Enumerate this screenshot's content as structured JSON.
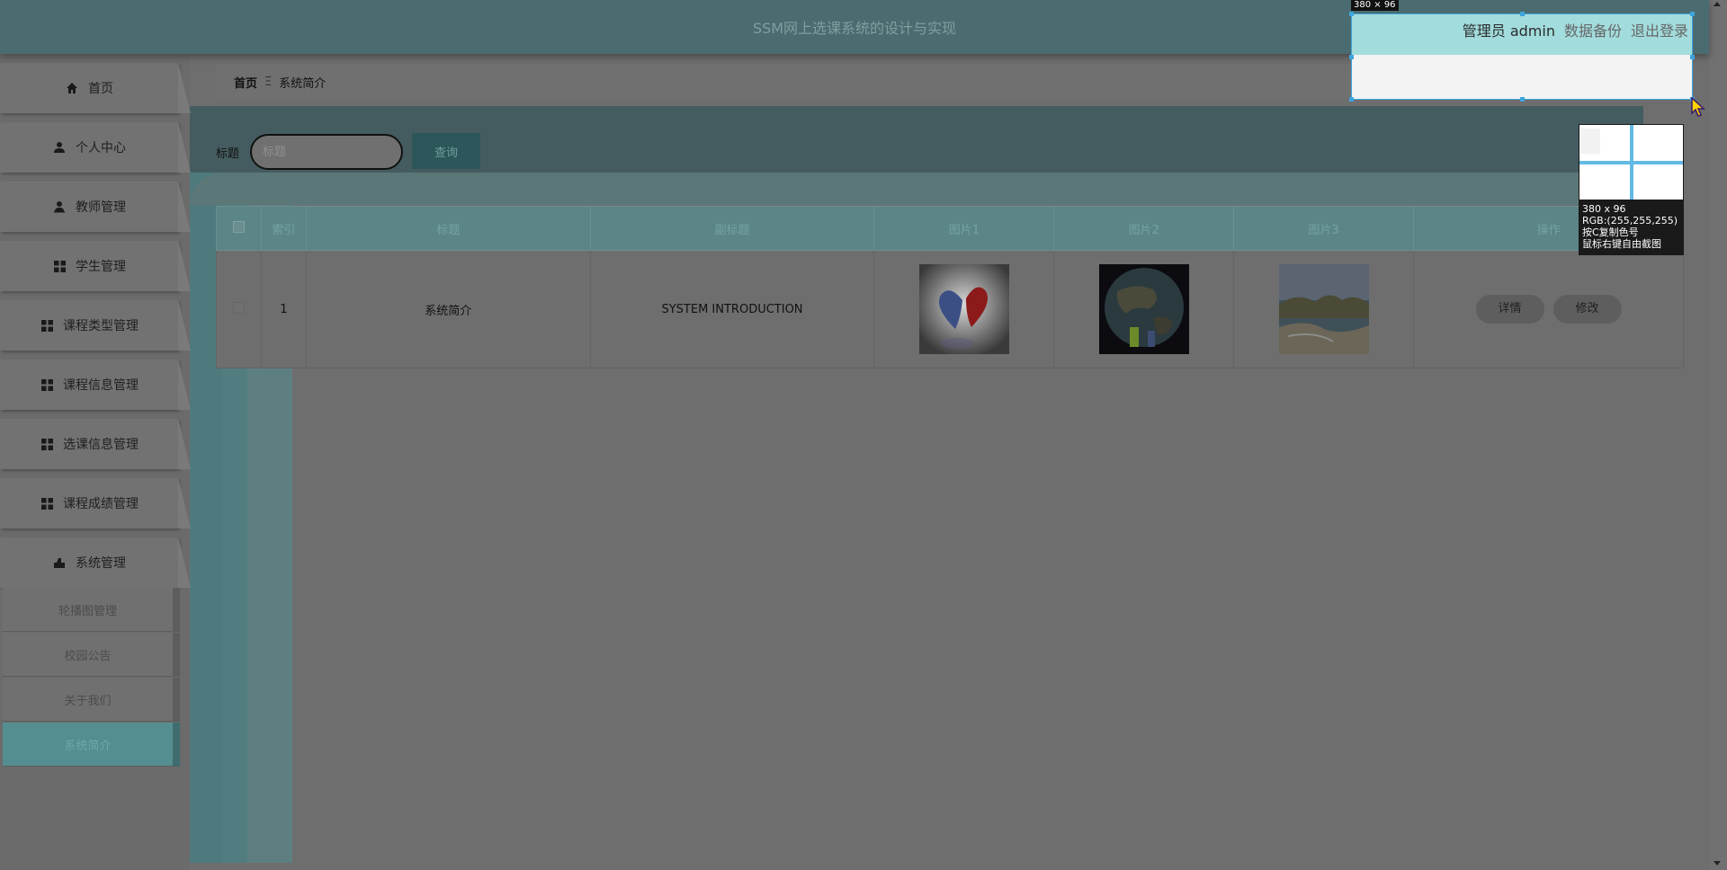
{
  "header": {
    "title": "SSM网上选课系统的设计与实现"
  },
  "user": {
    "role_name": "管理员 admin",
    "backup_label": "数据备份",
    "logout_label": "退出登录"
  },
  "sidebar": {
    "items": [
      {
        "label": "首页",
        "icon": "home-icon"
      },
      {
        "label": "个人中心",
        "icon": "user-icon"
      },
      {
        "label": "教师管理",
        "icon": "teacher-icon"
      },
      {
        "label": "学生管理",
        "icon": "grid-icon"
      },
      {
        "label": "课程类型管理",
        "icon": "grid-icon"
      },
      {
        "label": "课程信息管理",
        "icon": "grid-icon"
      },
      {
        "label": "选课信息管理",
        "icon": "grid-icon"
      },
      {
        "label": "课程成绩管理",
        "icon": "grid-icon"
      },
      {
        "label": "系统管理",
        "icon": "system-icon"
      }
    ],
    "subitems": [
      {
        "label": "轮播图管理"
      },
      {
        "label": "校园公告"
      },
      {
        "label": "关于我们"
      },
      {
        "label": "系统简介",
        "active": true
      }
    ]
  },
  "breadcrumb": {
    "home": "首页",
    "separator": "Ξ",
    "current": "系统简介"
  },
  "search": {
    "label": "标题",
    "placeholder": "标题",
    "button_label": "查询"
  },
  "table": {
    "headers": [
      "索引",
      "标题",
      "副标题",
      "图片1",
      "图片2",
      "图片3",
      "操作"
    ],
    "rows": [
      {
        "index": "1",
        "title": "系统简介",
        "subtitle": "SYSTEM INTRODUCTION",
        "detail_label": "详情",
        "edit_label": "修改"
      }
    ]
  },
  "snip_tool": {
    "size_label": "380 × 96",
    "mag_size": "380 x 96",
    "mag_rgb": "RGB:(255,255,255)",
    "mag_hint1": "按C复制色号",
    "mag_hint2": "鼠标右键自由截图"
  },
  "colors": {
    "accent": "#5c8588",
    "header_bg": "#4a6c70",
    "active_menu": "#548e91"
  }
}
